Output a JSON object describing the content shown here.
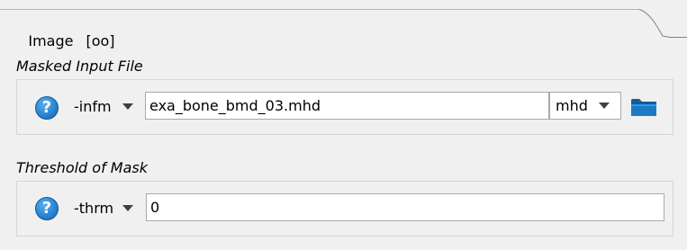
{
  "tab": {
    "title": "Image",
    "subtitle": "[oo]"
  },
  "sections": [
    {
      "title": "Masked Input File",
      "flag": "-infm",
      "value": "exa_bone_bmd_03.mhd",
      "format": "mhd"
    },
    {
      "title": "Threshold of Mask",
      "flag": "-thrm",
      "value": "0"
    }
  ],
  "icons": {
    "help": "help-icon",
    "browse": "folder-icon",
    "dropdown": "chevron-down-icon"
  },
  "help_glyph": "?",
  "colors": {
    "background": "#f0f0f0",
    "help_blue": "#2a86d1",
    "folder_blue": "#1a6fb0"
  }
}
